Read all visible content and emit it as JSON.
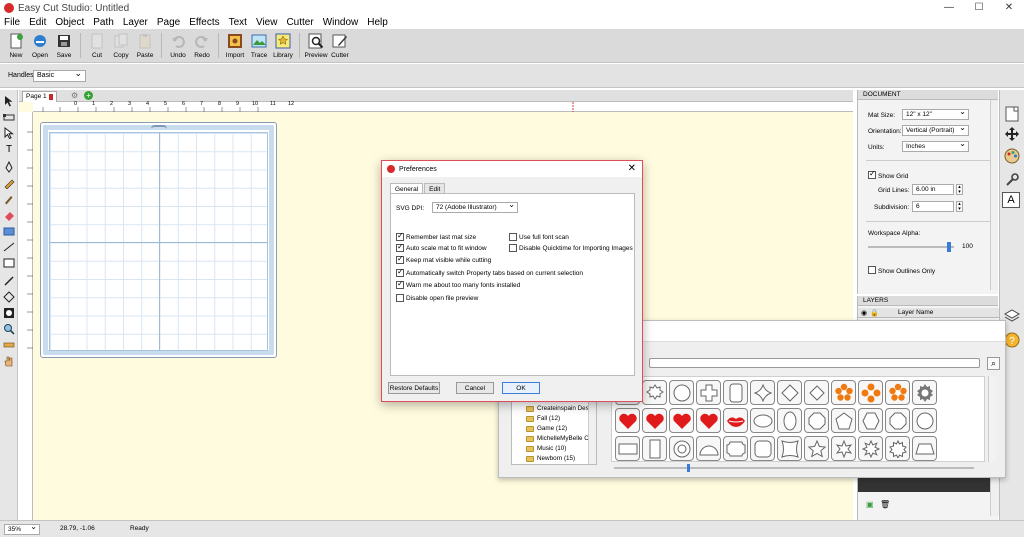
{
  "window": {
    "title": "Easy Cut Studio: Untitled",
    "controls": [
      "—",
      "☐",
      "✕"
    ]
  },
  "menu": [
    "File",
    "Edit",
    "Object",
    "Path",
    "Layer",
    "Page",
    "Effects",
    "Text",
    "View",
    "Cutter",
    "Window",
    "Help"
  ],
  "toolbar": {
    "buttons": [
      {
        "label": "New"
      },
      {
        "label": "Open"
      },
      {
        "label": "Save"
      },
      {
        "label": "Cut"
      },
      {
        "label": "Copy"
      },
      {
        "label": "Paste"
      },
      {
        "label": "Undo"
      },
      {
        "label": "Redo"
      },
      {
        "label": "Import"
      },
      {
        "label": "Trace"
      },
      {
        "label": "Library"
      },
      {
        "label": "Preview"
      },
      {
        "label": "Cutter"
      }
    ]
  },
  "handles": {
    "label": "Handles:",
    "value": "Basic"
  },
  "page_tab": {
    "label": "Page 1"
  },
  "ruler": {
    "ticks": [
      "0",
      "1",
      "2",
      "3",
      "4",
      "5",
      "6",
      "7",
      "8",
      "9",
      "10",
      "11",
      "12"
    ]
  },
  "document": {
    "header": "DOCUMENT",
    "mat_size_label": "Mat Size:",
    "mat_size_value": "12\" x 12\"",
    "orientation_label": "Orientation:",
    "orientation_value": "Vertical (Portrait)",
    "units_label": "Units:",
    "units_value": "Inches",
    "show_grid_label": "Show Grid",
    "grid_lines_label": "Grid Lines:",
    "grid_lines_value": "6.00 in",
    "subdivision_label": "Subdivision:",
    "subdivision_value": "6",
    "workspace_alpha_label": "Workspace Alpha:",
    "workspace_alpha_value": "100",
    "show_outlines_label": "Show Outlines Only"
  },
  "layers": {
    "header": "LAYERS",
    "column": "Layer Name"
  },
  "preferences": {
    "title": "Preferences",
    "tabs": [
      "General",
      "Edit"
    ],
    "svg_dpi_label": "SVG DPI:",
    "svg_dpi_value": "72 (Adobe Illustrator)",
    "options_left": [
      {
        "label": "Remember last mat size",
        "checked": true
      },
      {
        "label": "Auto scale mat to fit window",
        "checked": true
      },
      {
        "label": "Keep mat visible while cutting",
        "checked": true
      },
      {
        "label": "Automatically switch Property tabs based on current selection",
        "checked": true
      },
      {
        "label": "Warn me about too many fonts installed",
        "checked": true
      },
      {
        "label": "Disable open file preview",
        "checked": false
      }
    ],
    "options_right": [
      {
        "label": "Use full font scan",
        "checked": false
      },
      {
        "label": "Disable Quicktime for Importing Images",
        "checked": false
      }
    ],
    "restore_label": "Restore Defaults",
    "cancel_label": "Cancel",
    "ok_label": "OK"
  },
  "library": {
    "folders": [
      "Createinspain Desi",
      "Fall (12)",
      "Game (12)",
      "MichelleMyBelle Cre",
      "Music (10)",
      "Newborn (15)"
    ]
  },
  "status": {
    "zoom": "35%",
    "coords": "28.79, -1.06",
    "text": "Ready"
  },
  "colors": {
    "accent": "#3c7fd8",
    "dialog_border": "#e04d5a",
    "canvas": "#fffbdf",
    "shape_red": "#e0191b",
    "flower_orange": "#f07a10"
  }
}
